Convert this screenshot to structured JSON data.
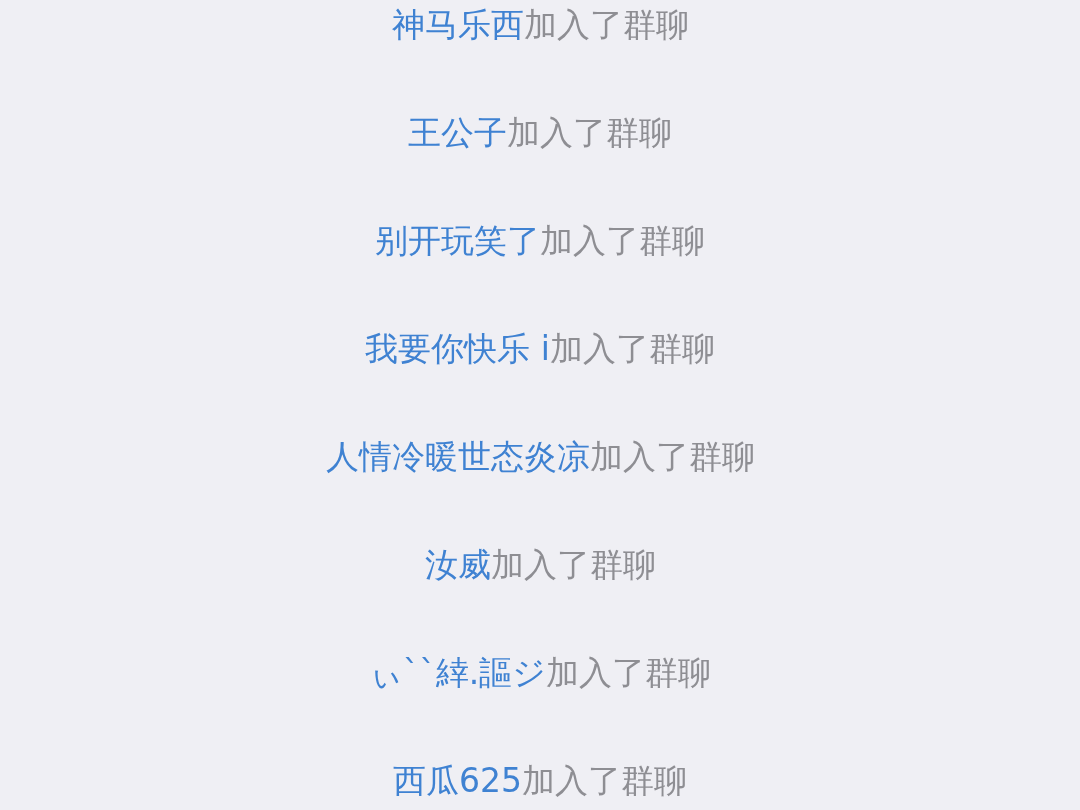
{
  "join_notices": [
    {
      "member": "神马乐西",
      "message": "加入了群聊"
    },
    {
      "member": "王公子",
      "message": "加入了群聊"
    },
    {
      "member": "别开玩笑了",
      "message": "加入了群聊"
    },
    {
      "member": "我要你快乐 i",
      "message": "加入了群聊"
    },
    {
      "member": "人情冷暖世态炎凉",
      "message": "加入了群聊"
    },
    {
      "member": "汝威",
      "message": "加入了群聊"
    },
    {
      "member": "ぃ``緈.謳ジ",
      "message": "加入了群聊"
    },
    {
      "member": "西瓜625",
      "message": "加入了群聊"
    }
  ]
}
